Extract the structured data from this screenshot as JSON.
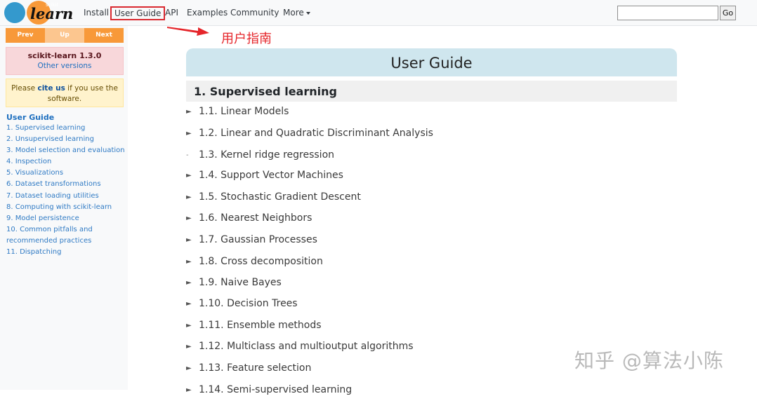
{
  "nav": {
    "logo_small": "scikit",
    "logo_text": "learn",
    "links": [
      "Install",
      "User Guide",
      "API",
      "Examples",
      "Community",
      "More"
    ],
    "search_placeholder": "",
    "go_label": "Go"
  },
  "annotation": {
    "text": "用户指南",
    "color": "#e5262b"
  },
  "sidebar": {
    "pager": [
      "Prev",
      "Up",
      "Next"
    ],
    "version_title": "scikit-learn 1.3.0",
    "version_link": "Other versions",
    "cite_prefix": "Please ",
    "cite_link": "cite us",
    "cite_suffix": " if you use the software.",
    "toc_title": "User Guide",
    "toc_items": [
      "1. Supervised learning",
      "2. Unsupervised learning",
      "3. Model selection and evaluation",
      "4. Inspection",
      "5. Visualizations",
      "6. Dataset transformations",
      "7. Dataset loading utilities",
      "8. Computing with scikit-learn",
      "9. Model persistence",
      "10. Common pitfalls and recommended practices",
      "11. Dispatching"
    ]
  },
  "main": {
    "title": "User Guide",
    "section": "1. Supervised learning",
    "items": [
      {
        "label": "1.1. Linear Models",
        "bullet": "►"
      },
      {
        "label": "1.2. Linear and Quadratic Discriminant Analysis",
        "bullet": "►"
      },
      {
        "label": "1.3. Kernel ridge regression",
        "bullet": "-"
      },
      {
        "label": "1.4. Support Vector Machines",
        "bullet": "►"
      },
      {
        "label": "1.5. Stochastic Gradient Descent",
        "bullet": "►"
      },
      {
        "label": "1.6. Nearest Neighbors",
        "bullet": "►"
      },
      {
        "label": "1.7. Gaussian Processes",
        "bullet": "►"
      },
      {
        "label": "1.8. Cross decomposition",
        "bullet": "►"
      },
      {
        "label": "1.9. Naive Bayes",
        "bullet": "►"
      },
      {
        "label": "1.10. Decision Trees",
        "bullet": "►"
      },
      {
        "label": "1.11. Ensemble methods",
        "bullet": "►"
      },
      {
        "label": "1.12. Multiclass and multioutput algorithms",
        "bullet": "►"
      },
      {
        "label": "1.13. Feature selection",
        "bullet": "►"
      },
      {
        "label": "1.14. Semi-supervised learning",
        "bullet": "►"
      }
    ]
  },
  "watermark": "知乎 @算法小陈"
}
